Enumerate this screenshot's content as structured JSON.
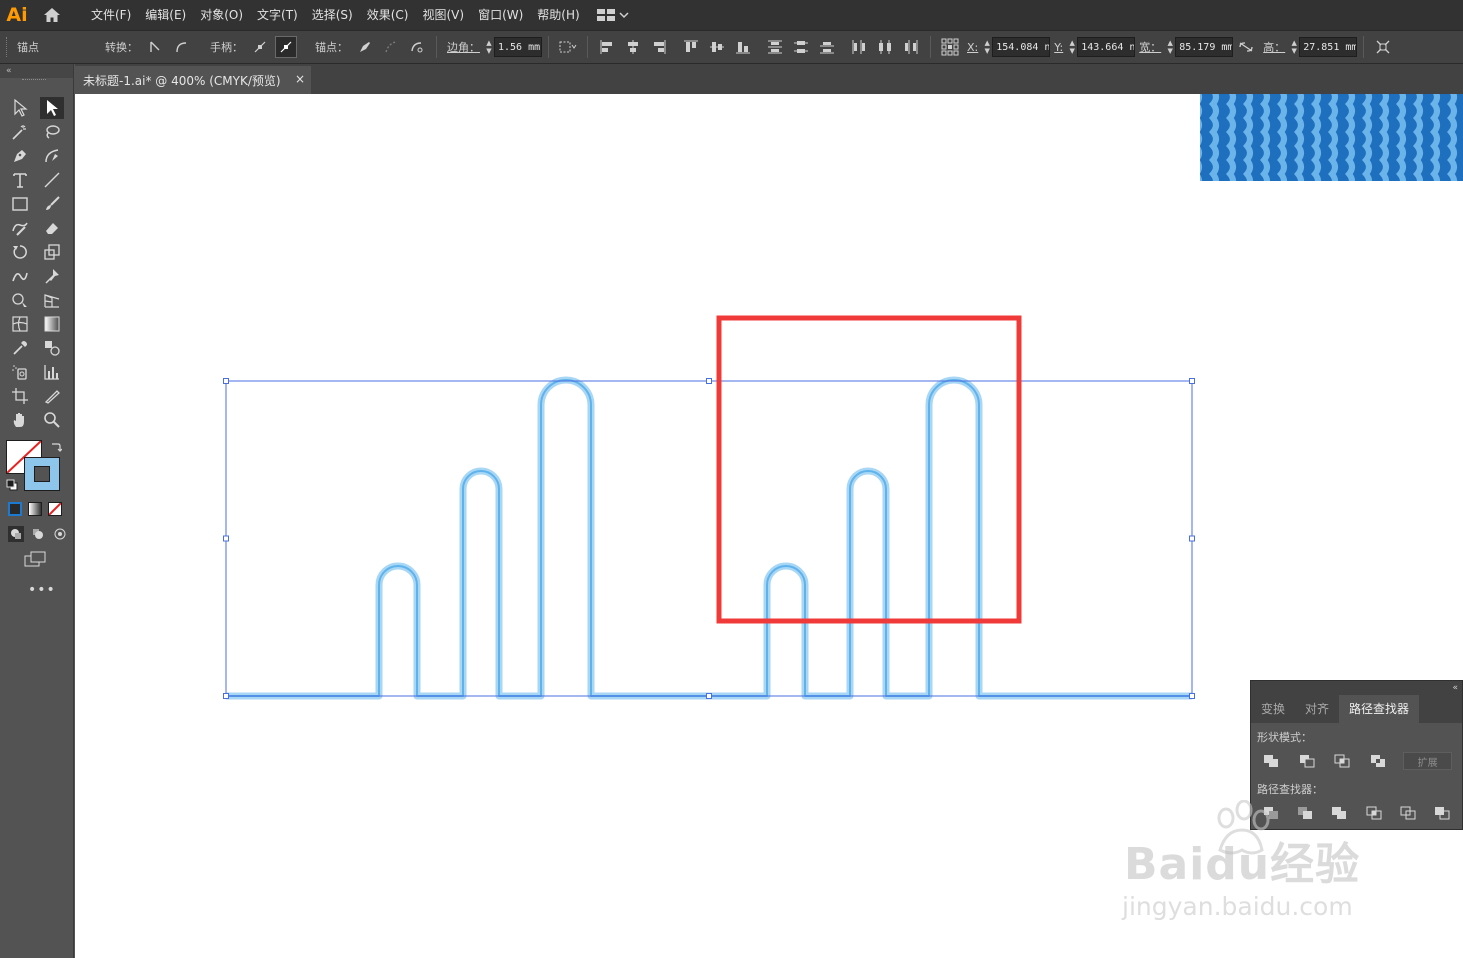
{
  "app": {
    "logo": "Ai",
    "accent": "#ff9a00"
  },
  "menubar": {
    "items": [
      "文件(F)",
      "编辑(E)",
      "对象(O)",
      "文字(T)",
      "选择(S)",
      "效果(C)",
      "视图(V)",
      "窗口(W)",
      "帮助(H)"
    ]
  },
  "controlbar": {
    "anchor_label": "锚点",
    "convert_label": "转换：",
    "handles_label": "手柄：",
    "anchors_label": "锚点：",
    "corner_label": "边角：",
    "corner_value": "1.56 mm",
    "x_label": "X:",
    "x_value": "154.084 n",
    "y_label": "Y:",
    "y_value": "143.664 n",
    "w_label": "宽：",
    "w_value": "85.179 mm",
    "h_label": "高：",
    "h_value": "27.851 mm"
  },
  "document": {
    "tab_title": "未标题-1.ai* @ 400% (CMYK/预览)",
    "close_glyph": "×"
  },
  "panel": {
    "tabs": [
      "变换",
      "对齐",
      "路径查找器"
    ],
    "active_tab": 2,
    "shape_modes_label": "形状模式：",
    "expand_label": "扩展",
    "pathfinders_label": "路径查找器："
  },
  "colors": {
    "selection": "#4a6fe0",
    "stroke_outer": "#a8d6f5",
    "stroke_inner": "#5fb3ec",
    "highlight_box": "#f03a3a",
    "wave_dark": "#1f6fbf",
    "wave_light": "#6ab4ea"
  },
  "watermark": {
    "brand": "Baidu经验",
    "site": "jingyan.baidu.com"
  }
}
